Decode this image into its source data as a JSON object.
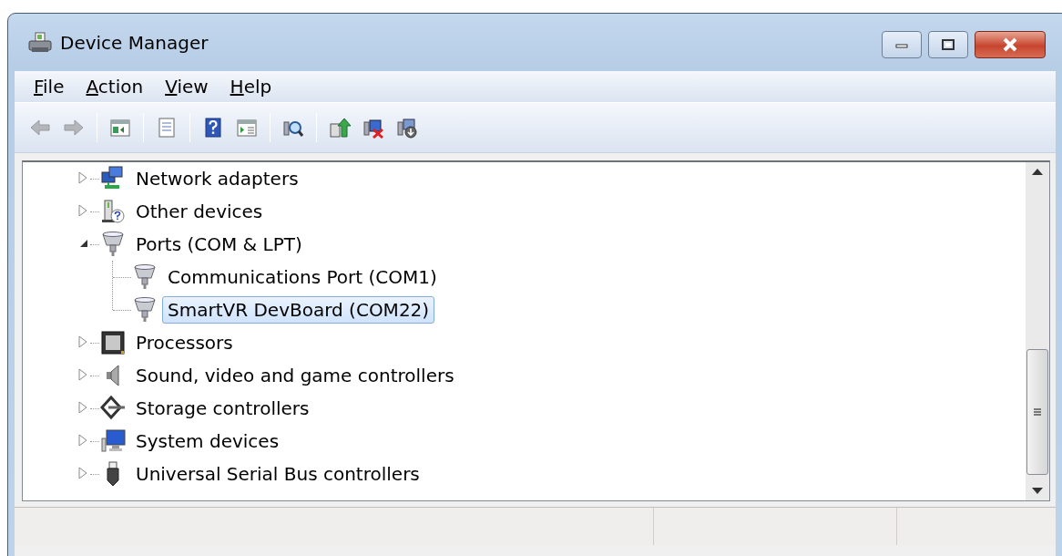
{
  "window": {
    "title": "Device Manager"
  },
  "menu": [
    {
      "label": "File",
      "underline_first": true
    },
    {
      "label": "Action",
      "underline_first": true
    },
    {
      "label": "View",
      "underline_first": true
    },
    {
      "label": "Help",
      "underline_first": true
    }
  ],
  "toolbar": [
    {
      "kind": "back",
      "disabled": true
    },
    {
      "kind": "forward",
      "disabled": true
    },
    {
      "kind": "separator"
    },
    {
      "kind": "console_tree",
      "disabled": false
    },
    {
      "kind": "separator"
    },
    {
      "kind": "properties",
      "disabled": false
    },
    {
      "kind": "separator"
    },
    {
      "kind": "help",
      "disabled": false
    },
    {
      "kind": "action_pane",
      "disabled": false
    },
    {
      "kind": "separator"
    },
    {
      "kind": "scan",
      "disabled": false
    },
    {
      "kind": "separator"
    },
    {
      "kind": "update",
      "disabled": false
    },
    {
      "kind": "uninstall",
      "disabled": false
    },
    {
      "kind": "disable",
      "disabled": false
    }
  ],
  "tree": {
    "items": [
      {
        "label": "Network adapters",
        "kind": "network",
        "expanded": false,
        "selected": false
      },
      {
        "label": "Other devices",
        "kind": "other",
        "expanded": false,
        "selected": false
      },
      {
        "label": "Ports (COM & LPT)",
        "kind": "port",
        "expanded": true,
        "selected": false,
        "children": [
          {
            "label": "Communications Port (COM1)",
            "kind": "port",
            "selected": false
          },
          {
            "label": "SmartVR DevBoard (COM22)",
            "kind": "port",
            "selected": true
          }
        ]
      },
      {
        "label": "Processors",
        "kind": "processor",
        "expanded": false,
        "selected": false
      },
      {
        "label": "Sound, video and game controllers",
        "kind": "sound",
        "expanded": false,
        "selected": false
      },
      {
        "label": "Storage controllers",
        "kind": "storage",
        "expanded": false,
        "selected": false
      },
      {
        "label": "System devices",
        "kind": "system",
        "expanded": false,
        "selected": false
      },
      {
        "label": "Universal Serial Bus controllers",
        "kind": "usb",
        "expanded": false,
        "selected": false
      }
    ]
  }
}
